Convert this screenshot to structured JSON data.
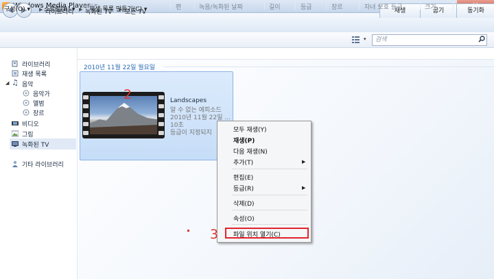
{
  "window": {
    "title": "Windows Media Player"
  },
  "nav": {
    "breadcrumb": [
      "라이브러리",
      "녹화된 TV",
      "모든 TV"
    ],
    "tabs": [
      "재생",
      "굽기",
      "동기화"
    ]
  },
  "toolbar": {
    "organize": "구성(O)",
    "stream": "스트림(R)",
    "create_playlist": "재생 목록 만들기(C)"
  },
  "search": {
    "placeholder": "검색"
  },
  "sidebar": {
    "items": [
      "라이브러리",
      "재생 목록",
      "음악",
      "음악가",
      "앨범",
      "장르",
      "비디오",
      "그림",
      "녹화된 TV",
      "기타 라이브러리"
    ]
  },
  "columns": [
    "시리즈",
    "편",
    "녹음/녹화된 날짜",
    "길이",
    "등급",
    "장르",
    "자녀 보호 등급",
    "크기"
  ],
  "group": {
    "date": "2010년 11월 22일 월요일"
  },
  "item": {
    "title": "Landscapes",
    "episode": "알 수 없는 에피소드",
    "date": "2010년 11월 22일 ...",
    "length": "10초",
    "rating": "등급이 지정되지"
  },
  "context_menu": {
    "items": [
      "모두 재생(Y)",
      "재생(P)",
      "다음 재생(N)",
      "추가(T)",
      "편집(E)",
      "등급(R)",
      "삭제(D)",
      "속성(O)",
      "파일 위치 열기(C)"
    ]
  },
  "annotations": [
    "2",
    "3"
  ],
  "colors": {
    "highlight": "#e3212b",
    "selection": "#c6ddf8",
    "accent": "#2a6bb5"
  }
}
